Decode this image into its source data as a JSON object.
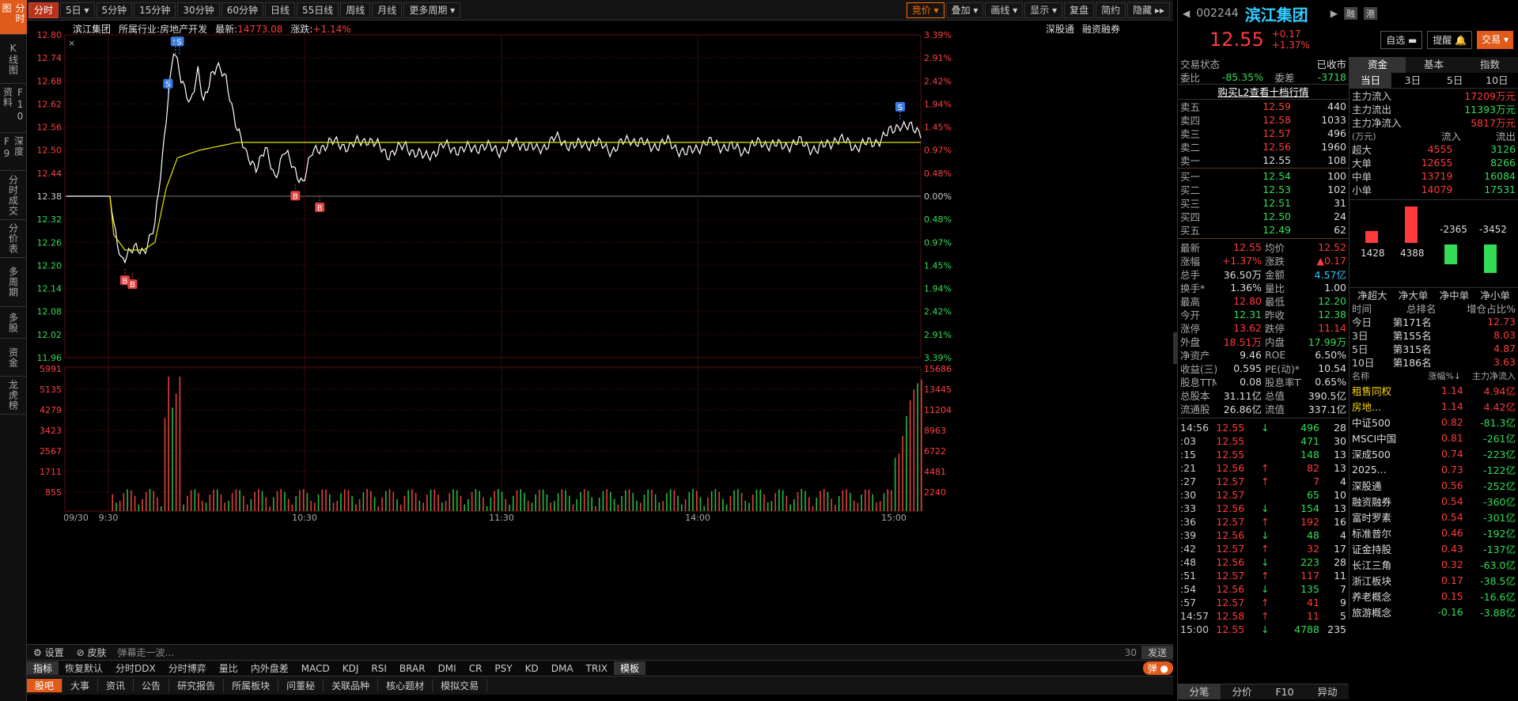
{
  "left_tabs": [
    "分时图",
    "K线图",
    "F10资料",
    "深度F9",
    "分时成交",
    "分价表",
    "多周期",
    "多股",
    "资金",
    "龙虎榜"
  ],
  "periods": [
    "分时",
    "5日",
    "5分钟",
    "15分钟",
    "30分钟",
    "60分钟",
    "日线",
    "55日线",
    "周线",
    "月线",
    "更多周期"
  ],
  "right_tools": [
    "竞价",
    "叠加",
    "画线",
    "显示",
    "复盘",
    "简约",
    "隐藏"
  ],
  "info": {
    "name": "滨江集团",
    "industry_label": "所属行业:",
    "industry": "房地产开发",
    "latest_label": "最新:",
    "latest": "14773.08",
    "change_label": "涨跌:",
    "change": "+1.14%",
    "sgt": "深股通",
    "rzrq": "融资融券"
  },
  "colors": {
    "price_line": "#ffffff",
    "avg_line": "#e6e600",
    "up": "#ff3b3b",
    "down": "#33dd55",
    "grid": "#3a0a0a"
  },
  "chart_data": {
    "type": "line",
    "price_ticks": [
      "12.80",
      "12.74",
      "12.68",
      "12.62",
      "12.56",
      "12.50",
      "12.44",
      "12.38",
      "12.32",
      "12.26",
      "12.20",
      "12.14",
      "12.08",
      "12.02",
      "11.96"
    ],
    "pct_ticks": [
      "3.39%",
      "2.91%",
      "2.42%",
      "1.94%",
      "1.45%",
      "0.97%",
      "0.48%",
      "0.00%",
      "0.48%",
      "0.97%",
      "1.45%",
      "1.94%",
      "2.42%",
      "2.91%",
      "3.39%"
    ],
    "vol_ticks": [
      "5991",
      "5135",
      "4279",
      "3423",
      "2567",
      "1711",
      "855"
    ],
    "vol_ticks_right": [
      "15686",
      "13445",
      "11204",
      "8963",
      "6722",
      "4481",
      "2240"
    ],
    "time_labels": [
      "09/30",
      "9:30",
      "10:30",
      "11:30",
      "14:00",
      "15:00"
    ],
    "prev_close": 12.38,
    "ylim": [
      11.96,
      12.8
    ],
    "price_key": [
      [
        0,
        12.38
      ],
      [
        2,
        12.38
      ],
      [
        4,
        12.3
      ],
      [
        8,
        12.22
      ],
      [
        15,
        12.24
      ],
      [
        20,
        12.24
      ],
      [
        26,
        12.3
      ],
      [
        30,
        12.48
      ],
      [
        33,
        12.64
      ],
      [
        36,
        12.76
      ],
      [
        40,
        12.68
      ],
      [
        45,
        12.63
      ],
      [
        49,
        12.7
      ],
      [
        52,
        12.62
      ],
      [
        56,
        12.7
      ],
      [
        59,
        12.72
      ],
      [
        64,
        12.68
      ],
      [
        70,
        12.56
      ],
      [
        75,
        12.48
      ],
      [
        80,
        12.46
      ],
      [
        85,
        12.5
      ],
      [
        90,
        12.43
      ],
      [
        95,
        12.5
      ],
      [
        100,
        12.45
      ],
      [
        105,
        12.42
      ],
      [
        110,
        12.49
      ],
      [
        115,
        12.51
      ],
      [
        120,
        12.52
      ],
      [
        130,
        12.51
      ],
      [
        140,
        12.53
      ],
      [
        150,
        12.49
      ],
      [
        160,
        12.51
      ],
      [
        170,
        12.48
      ],
      [
        180,
        12.51
      ],
      [
        190,
        12.5
      ],
      [
        200,
        12.51
      ],
      [
        210,
        12.5
      ],
      [
        220,
        12.52
      ],
      [
        230,
        12.5
      ],
      [
        240,
        12.53
      ],
      [
        250,
        12.51
      ],
      [
        260,
        12.52
      ],
      [
        270,
        12.5
      ],
      [
        280,
        12.53
      ],
      [
        290,
        12.51
      ],
      [
        300,
        12.52
      ],
      [
        310,
        12.49
      ],
      [
        320,
        12.52
      ],
      [
        330,
        12.51
      ],
      [
        340,
        12.5
      ],
      [
        350,
        12.52
      ],
      [
        360,
        12.51
      ],
      [
        370,
        12.52
      ],
      [
        380,
        12.5
      ],
      [
        390,
        12.53
      ],
      [
        400,
        12.51
      ],
      [
        410,
        12.52
      ],
      [
        420,
        12.55
      ],
      [
        424,
        12.57
      ],
      [
        428,
        12.56
      ],
      [
        432,
        12.55
      ],
      [
        435,
        12.55
      ]
    ],
    "avg_key": [
      [
        2,
        12.38
      ],
      [
        4,
        12.28
      ],
      [
        10,
        12.24
      ],
      [
        20,
        12.24
      ],
      [
        26,
        12.26
      ],
      [
        32,
        12.4
      ],
      [
        38,
        12.48
      ],
      [
        50,
        12.5
      ],
      [
        70,
        12.52
      ],
      [
        90,
        12.52
      ],
      [
        150,
        12.52
      ],
      [
        300,
        12.52
      ],
      [
        435,
        12.52
      ]
    ],
    "bs_marks": [
      {
        "t": "B",
        "i": 10,
        "p": 12.19
      },
      {
        "t": "B",
        "i": 14,
        "p": 12.18
      },
      {
        "t": "S",
        "i": 33,
        "p": 12.64
      },
      {
        "t": "S",
        "i": 37,
        "p": 12.75
      },
      {
        "t": "S",
        "i": 39,
        "p": 12.75
      },
      {
        "t": "B",
        "i": 101,
        "p": 12.41
      },
      {
        "t": "B",
        "i": 114,
        "p": 12.38
      },
      {
        "t": "S",
        "i": 424,
        "p": 12.58
      }
    ]
  },
  "right": {
    "code": "002244",
    "name": "滨江集团",
    "tags": [
      "融",
      "港"
    ],
    "price": "12.55",
    "change": "+0.17",
    "pct": "+1.37%",
    "zixuan": "自选",
    "tixing": "提醒",
    "jiaoyi": "交易",
    "status_label": "交易状态",
    "status": "已收市",
    "weibi_label": "委比",
    "weibi": "-85.35%",
    "weicha_label": "委差",
    "weicha": "-3718",
    "l2": "购买L2查看十档行情",
    "asks": [
      {
        "n": "卖五",
        "p": "12.59",
        "v": "440"
      },
      {
        "n": "卖四",
        "p": "12.58",
        "v": "1033"
      },
      {
        "n": "卖三",
        "p": "12.57",
        "v": "496"
      },
      {
        "n": "卖二",
        "p": "12.56",
        "v": "1960"
      },
      {
        "n": "卖一",
        "p": "12.55",
        "v": "108"
      }
    ],
    "bids": [
      {
        "n": "买一",
        "p": "12.54",
        "v": "100"
      },
      {
        "n": "买二",
        "p": "12.53",
        "v": "102"
      },
      {
        "n": "买三",
        "p": "12.51",
        "v": "31"
      },
      {
        "n": "买四",
        "p": "12.50",
        "v": "24"
      },
      {
        "n": "买五",
        "p": "12.49",
        "v": "62"
      }
    ],
    "stats": [
      [
        "最新",
        "12.55",
        "均价",
        "12.52"
      ],
      [
        "涨幅",
        "+1.37%",
        "涨跌",
        "▲0.17"
      ],
      [
        "总手",
        "36.50万",
        "金额",
        "4.57亿"
      ],
      [
        "换手*",
        "1.36%",
        "量比",
        "1.00"
      ],
      [
        "最高",
        "12.80",
        "最低",
        "12.20"
      ],
      [
        "今开",
        "12.31",
        "昨收",
        "12.38"
      ],
      [
        "涨停",
        "13.62",
        "跌停",
        "11.14"
      ],
      [
        "外盘",
        "18.51万",
        "内盘",
        "17.99万"
      ],
      [
        "净资产",
        "9.46",
        "ROE",
        "6.50%"
      ],
      [
        "收益(三)",
        "0.595",
        "PE(动)*",
        "10.54"
      ],
      [
        "股息TTM",
        "0.08",
        "股息率TTM",
        "0.65%"
      ],
      [
        "总股本",
        "31.11亿",
        "总值",
        "390.5亿"
      ],
      [
        "流通股",
        "26.86亿",
        "流值",
        "337.1亿"
      ]
    ],
    "ticks": [
      [
        "14:56",
        "12.55",
        "↓",
        "496",
        "28"
      ],
      [
        ":03",
        "12.55",
        "",
        "471",
        "30"
      ],
      [
        ":15",
        "12.55",
        "",
        "148",
        "13"
      ],
      [
        ":21",
        "12.56",
        "↑",
        "82",
        "13"
      ],
      [
        ":27",
        "12.57",
        "↑",
        "7",
        "4"
      ],
      [
        ":30",
        "12.57",
        "",
        "65",
        "10"
      ],
      [
        ":33",
        "12.56",
        "↓",
        "154",
        "13"
      ],
      [
        ":36",
        "12.57",
        "↑",
        "192",
        "16"
      ],
      [
        ":39",
        "12.56",
        "↓",
        "48",
        "4"
      ],
      [
        ":42",
        "12.57",
        "↑",
        "32",
        "17"
      ],
      [
        ":48",
        "12.56",
        "↓",
        "223",
        "28"
      ],
      [
        ":51",
        "12.57",
        "↑",
        "117",
        "11"
      ],
      [
        ":54",
        "12.56",
        "↓",
        "135",
        "7"
      ],
      [
        ":57",
        "12.57",
        "↑",
        "41",
        "9"
      ],
      [
        "14:57",
        "12.58",
        "↑",
        "11",
        "5"
      ],
      [
        "15:00",
        "12.55",
        "↓",
        "4788",
        "235"
      ]
    ],
    "bottom_tabs": [
      "分笔",
      "分价",
      "F10",
      "异动"
    ],
    "fund_tabs": [
      "资金",
      "基本",
      "指数"
    ],
    "fund_days": [
      "当日",
      "3日",
      "5日",
      "10日"
    ],
    "flows": [
      [
        "主力流入",
        "17209万元"
      ],
      [
        "主力流出",
        "11393万元"
      ],
      [
        "主力净流入",
        "5817万元"
      ]
    ],
    "flow_unit": "(万元)",
    "flow_in": "流入",
    "flow_out": "流出",
    "flow_table": [
      [
        "超大",
        "4555",
        "3126"
      ],
      [
        "大单",
        "12655",
        "8266"
      ],
      [
        "中单",
        "13719",
        "16084"
      ],
      [
        "小单",
        "14079",
        "17531"
      ]
    ],
    "bars": [
      {
        "v": 1428,
        "label": "1428"
      },
      {
        "v": 4388,
        "label": "4388"
      },
      {
        "v": -2365,
        "label": "-2365"
      },
      {
        "v": -3452,
        "label": "-3452"
      }
    ],
    "bar_names": [
      "净超大",
      "净大单",
      "净中单",
      "净小单"
    ],
    "rank_head": [
      "时间",
      "总排名",
      "增仓占比%"
    ],
    "rank": [
      [
        "今日",
        "第171名",
        "12.73"
      ],
      [
        "3日",
        "第155名",
        "8.03"
      ],
      [
        "5日",
        "第315名",
        "4.87"
      ],
      [
        "10日",
        "第186名",
        "3.63"
      ]
    ],
    "sector_head": [
      "名称",
      "涨幅%↓",
      "主力净流入"
    ],
    "sectors": [
      [
        "租售同权",
        "1.14",
        "4.94亿",
        1
      ],
      [
        "房地...",
        "1.14",
        "4.42亿",
        1
      ],
      [
        "中证500",
        "0.82",
        "-81.3亿",
        0
      ],
      [
        "MSCI中国",
        "0.81",
        "-261亿",
        0
      ],
      [
        "深成500",
        "0.74",
        "-223亿",
        0
      ],
      [
        "2025...",
        "0.73",
        "-122亿",
        0
      ],
      [
        "深股通",
        "0.56",
        "-252亿",
        0
      ],
      [
        "融资融券",
        "0.54",
        "-360亿",
        0
      ],
      [
        "富时罗素",
        "0.54",
        "-301亿",
        0
      ],
      [
        "标准普尔",
        "0.46",
        "-192亿",
        0
      ],
      [
        "证金持股",
        "0.43",
        "-137亿",
        0
      ],
      [
        "长江三角",
        "0.32",
        "-63.0亿",
        0
      ],
      [
        "浙江板块",
        "0.17",
        "-38.5亿",
        0
      ],
      [
        "养老概念",
        "0.15",
        "-16.6亿",
        0
      ],
      [
        "旅游概念",
        "-0.16",
        "-3.88亿",
        0
      ]
    ]
  },
  "bottom": {
    "settings": "设置",
    "skin": "皮肤",
    "danmu": "弹幕走一波...",
    "count": "30",
    "send": "发送",
    "indicators": [
      "指标",
      "恢复默认",
      "分时DDX",
      "分时博弈",
      "量比",
      "内外盘差",
      "MACD",
      "KDJ",
      "RSI",
      "BRAR",
      "DMI",
      "CR",
      "PSY",
      "KD",
      "DMA",
      "TRIX",
      "模板"
    ],
    "tabs": [
      "股吧",
      "大事",
      "资讯",
      "公告",
      "研究报告",
      "所属板块",
      "问董秘",
      "关联品种",
      "核心题材",
      "模拟交易"
    ],
    "dan": "弹"
  }
}
